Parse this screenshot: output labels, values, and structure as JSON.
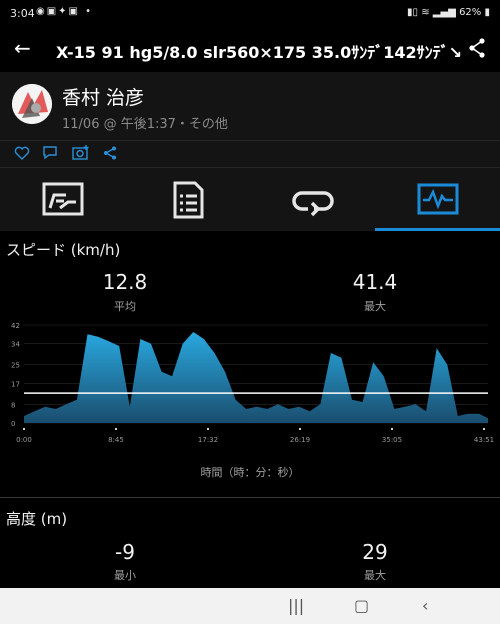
{
  "status_bar": {
    "time": "3:04",
    "battery": "62%"
  },
  "header": {
    "title": "X-15 91 hg5/8.0 slr560×175 35.0ｻﾝﾃﾞ142ｻﾝﾃﾞ↘2.0℃"
  },
  "activity": {
    "author": "香村 治彦",
    "meta": "11/06 @ 午後1:37・その他"
  },
  "tabs": [
    {
      "icon": "summary-icon",
      "active": false
    },
    {
      "icon": "details-icon",
      "active": false
    },
    {
      "icon": "laps-icon",
      "active": false
    },
    {
      "icon": "charts-icon",
      "active": true
    }
  ],
  "speed": {
    "title": "スピード (km/h)",
    "avg_value": "12.8",
    "avg_label": "平均",
    "max_value": "41.4",
    "max_label": "最大",
    "x_axis_label": "時間（時：分：秒）"
  },
  "altitude": {
    "title": "高度 (m)",
    "min_value": "-9",
    "min_label": "最小",
    "max_value": "29",
    "max_label": "最大"
  },
  "chart_data": {
    "type": "area",
    "title": "",
    "xlabel": "時間（時：分：秒）",
    "ylabel": "",
    "y_ticks": [
      "42",
      "34",
      "25",
      "17",
      "8",
      "0"
    ],
    "x_ticks": [
      "0:00",
      "8:45",
      "17:32",
      "26:19",
      "35:05",
      "43:51"
    ],
    "ylim": [
      0,
      42
    ],
    "average_line": 12.8,
    "colors": {
      "fill_top": "#29a9e0",
      "fill_bottom": "#1a4e6e",
      "avg_line": "#ffffff"
    },
    "x_minutes": [
      0,
      1,
      2,
      3,
      4,
      5,
      6,
      7,
      8,
      9,
      10,
      11,
      12,
      13,
      14,
      15,
      16,
      17,
      18,
      19,
      20,
      21,
      22,
      23,
      24,
      25,
      26,
      27,
      28,
      29,
      30,
      31,
      32,
      33,
      34,
      35,
      36,
      37,
      38,
      39,
      40,
      41,
      42,
      43,
      43.85
    ],
    "values": [
      3,
      5,
      7,
      6,
      8,
      10,
      38,
      37,
      35,
      33,
      7,
      36,
      34,
      22,
      20,
      34,
      39,
      36,
      30,
      22,
      10,
      6,
      7,
      6,
      8,
      6,
      7,
      5,
      8,
      30,
      28,
      10,
      9,
      26,
      20,
      6,
      7,
      8,
      5,
      32,
      25,
      3,
      4,
      4,
      2
    ]
  }
}
